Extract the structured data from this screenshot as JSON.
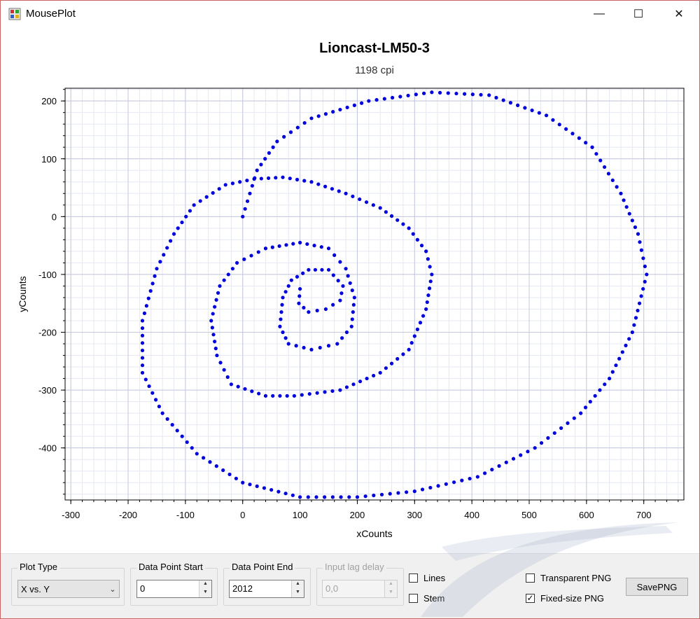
{
  "window": {
    "title": "MousePlot",
    "minimize_glyph": "—",
    "maximize_glyph": "☐",
    "close_glyph": "✕",
    "icon": "app-chart-icon"
  },
  "chart_data": {
    "type": "scatter",
    "title": "Lioncast-LM50-3",
    "subtitle": "1198 cpi",
    "xlabel": "xCounts",
    "ylabel": "yCounts",
    "xlim": [
      -310,
      770
    ],
    "ylim": [
      -490,
      222
    ],
    "xticks": [
      -300,
      -200,
      -100,
      0,
      100,
      200,
      300,
      400,
      500,
      600,
      700
    ],
    "yticks": [
      200,
      100,
      0,
      -100,
      -200,
      -300,
      -400
    ],
    "grid": true,
    "marker_color": "#0000dd",
    "spiral_waypoints": [
      [
        0,
        0
      ],
      [
        25,
        80
      ],
      [
        60,
        130
      ],
      [
        120,
        170
      ],
      [
        220,
        200
      ],
      [
        330,
        215
      ],
      [
        430,
        210
      ],
      [
        530,
        175
      ],
      [
        610,
        120
      ],
      [
        660,
        40
      ],
      [
        690,
        -30
      ],
      [
        705,
        -100
      ],
      [
        680,
        -200
      ],
      [
        640,
        -280
      ],
      [
        590,
        -340
      ],
      [
        510,
        -400
      ],
      [
        410,
        -450
      ],
      [
        300,
        -475
      ],
      [
        200,
        -485
      ],
      [
        100,
        -485
      ],
      [
        0,
        -460
      ],
      [
        -80,
        -410
      ],
      [
        -140,
        -340
      ],
      [
        -175,
        -270
      ],
      [
        -175,
        -180
      ],
      [
        -150,
        -90
      ],
      [
        -120,
        -30
      ],
      [
        -85,
        20
      ],
      [
        -30,
        55
      ],
      [
        20,
        65
      ],
      [
        70,
        68
      ],
      [
        120,
        60
      ],
      [
        180,
        40
      ],
      [
        240,
        15
      ],
      [
        290,
        -20
      ],
      [
        320,
        -60
      ],
      [
        330,
        -100
      ],
      [
        320,
        -160
      ],
      [
        290,
        -230
      ],
      [
        240,
        -270
      ],
      [
        170,
        -300
      ],
      [
        90,
        -310
      ],
      [
        40,
        -310
      ],
      [
        -20,
        -290
      ],
      [
        -45,
        -240
      ],
      [
        -55,
        -180
      ],
      [
        -40,
        -120
      ],
      [
        -10,
        -80
      ],
      [
        40,
        -55
      ],
      [
        100,
        -45
      ],
      [
        150,
        -55
      ],
      [
        180,
        -90
      ],
      [
        195,
        -140
      ],
      [
        190,
        -190
      ],
      [
        165,
        -220
      ],
      [
        120,
        -230
      ],
      [
        80,
        -220
      ],
      [
        65,
        -190
      ],
      [
        70,
        -140
      ],
      [
        85,
        -110
      ],
      [
        115,
        -92
      ],
      [
        150,
        -92
      ],
      [
        175,
        -120
      ],
      [
        170,
        -145
      ],
      [
        145,
        -160
      ],
      [
        115,
        -165
      ],
      [
        98,
        -150
      ],
      [
        100,
        -125
      ]
    ]
  },
  "controls": {
    "plot_type": {
      "label": "Plot Type",
      "value": "X vs. Y"
    },
    "data_point_start": {
      "label": "Data Point Start",
      "value": "0"
    },
    "data_point_end": {
      "label": "Data Point End",
      "value": "2012"
    },
    "input_lag_delay": {
      "label": "Input lag delay",
      "value": "0,0"
    },
    "lines": {
      "label": "Lines",
      "checked": false
    },
    "stem": {
      "label": "Stem",
      "checked": false
    },
    "transparent_png": {
      "label": "Transparent PNG",
      "checked": false
    },
    "fixed_size_png": {
      "label": "Fixed-size PNG",
      "checked": true
    },
    "save_png": {
      "label": "SavePNG"
    }
  }
}
